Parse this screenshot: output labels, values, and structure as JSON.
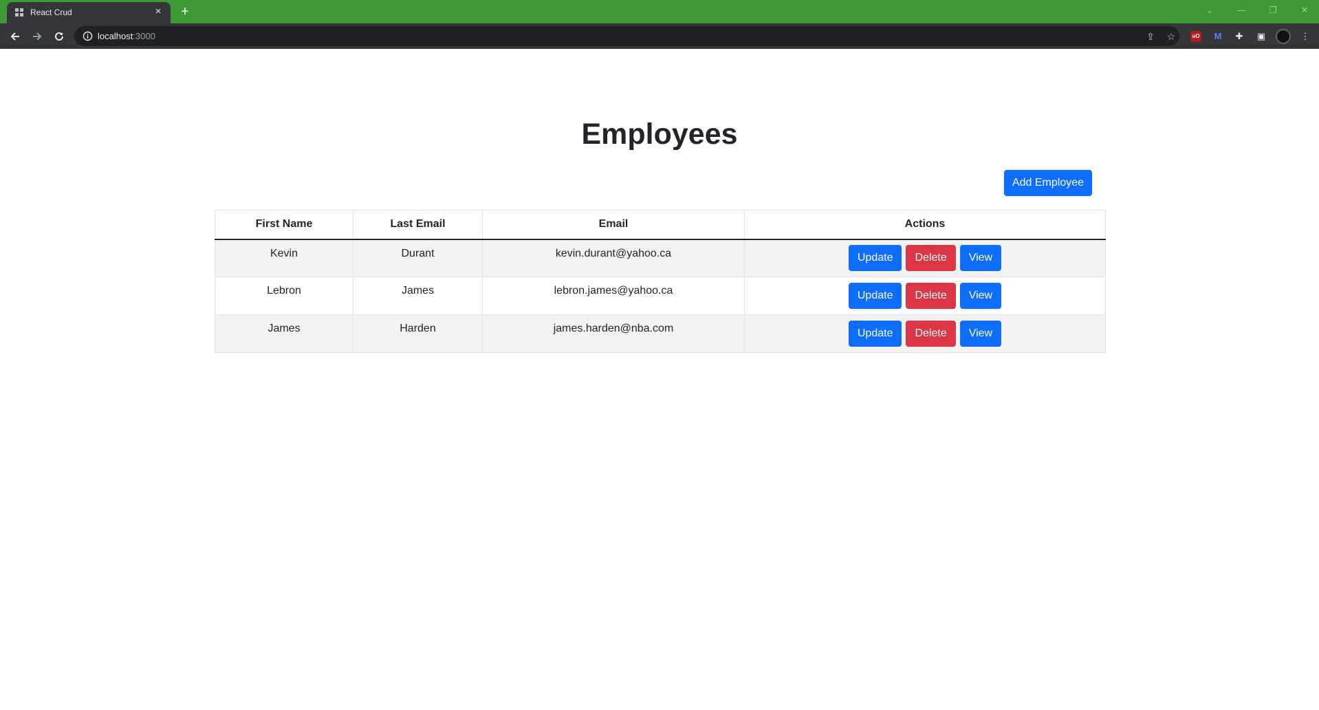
{
  "browser": {
    "tab_title": "React Crud",
    "tab_close": "×",
    "new_tab": "+",
    "url_host": "localhost",
    "url_port": ":3000"
  },
  "page": {
    "title": "Employees",
    "add_button": "Add Employee"
  },
  "table": {
    "headers": [
      "First Name",
      "Last Email",
      "Email",
      "Actions"
    ],
    "rows": [
      {
        "first_name": "Kevin",
        "last_name": "Durant",
        "email": "kevin.durant@yahoo.ca"
      },
      {
        "first_name": "Lebron",
        "last_name": "James",
        "email": "lebron.james@yahoo.ca"
      },
      {
        "first_name": "James",
        "last_name": "Harden",
        "email": "james.harden@nba.com"
      }
    ],
    "actions": {
      "update": "Update",
      "delete": "Delete",
      "view": "View"
    }
  },
  "colors": {
    "chrome_frame": "#3e9a34",
    "primary": "#0d6efd",
    "danger": "#dc3545",
    "stripe": "#f2f2f2"
  }
}
